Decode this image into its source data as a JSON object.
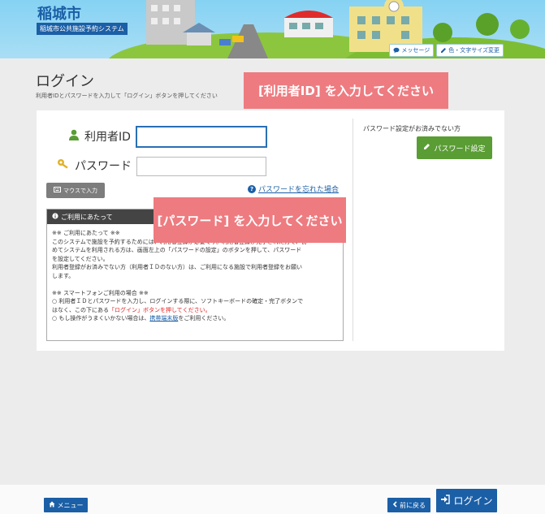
{
  "header": {
    "city_name": "稲城市",
    "system_name": "稲城市公共施設予約システム",
    "message_label": "メッセージ",
    "color_font_label": "色・文字サイズ変更"
  },
  "page": {
    "title": "ログイン",
    "subtitle": "利用者IDとパスワードを入力して「ログイン」ボタンを押してください"
  },
  "form": {
    "user_id_label": "利用者ID",
    "user_id_value": "",
    "password_label": "パスワード",
    "password_value": "",
    "mouse_input_label": "マウスで入力",
    "forgot_password_label": "パスワードを忘れた場合"
  },
  "notice": {
    "heading": "ご利用にあたって",
    "line1": "※※ ご利用にあたって ※※",
    "line2": "このシステムで施設を予約するためには、利用者登録が必要です。利用者登録が完了された方で、初",
    "line3": "めてシステムを利用される方は、画面左上の「パスワードの設定」のボタンを押して、パスワード",
    "line4": "を設定してください。",
    "line5": "利用者登録がお済みでない方（利用者ＩＤのない方）は、ご利用になる施設で利用者登録をお願い",
    "line6": "します。",
    "line7": "※※ スマートフォンご利用の場合 ※※",
    "line8": "○ 利用者ＩＤとパスワードを入力し、ログインする際に、ソフトキーボードの確定・完了ボタンで",
    "line9_pre": "はなく、この下にある",
    "line9_red": "「ログイン」ボタンを押してください。",
    "line10_pre": "○ もし操作がうまくいかない場合は、",
    "line10_link": "携帯端末版",
    "line10_post": "をご利用ください。"
  },
  "right": {
    "text": "パスワード設定がお済みでない方",
    "set_button": "パスワード設定"
  },
  "callouts": {
    "user_id": "[利用者ID] を入力してください",
    "password": "[パスワード] を入力してください"
  },
  "footer": {
    "menu_label": "メニュー",
    "back_label": "前に戻る",
    "login_label": "ログイン"
  },
  "colors": {
    "brand_blue": "#1b5fa6",
    "callout_pink": "#ee7b80",
    "green_button": "#5a9d34"
  }
}
